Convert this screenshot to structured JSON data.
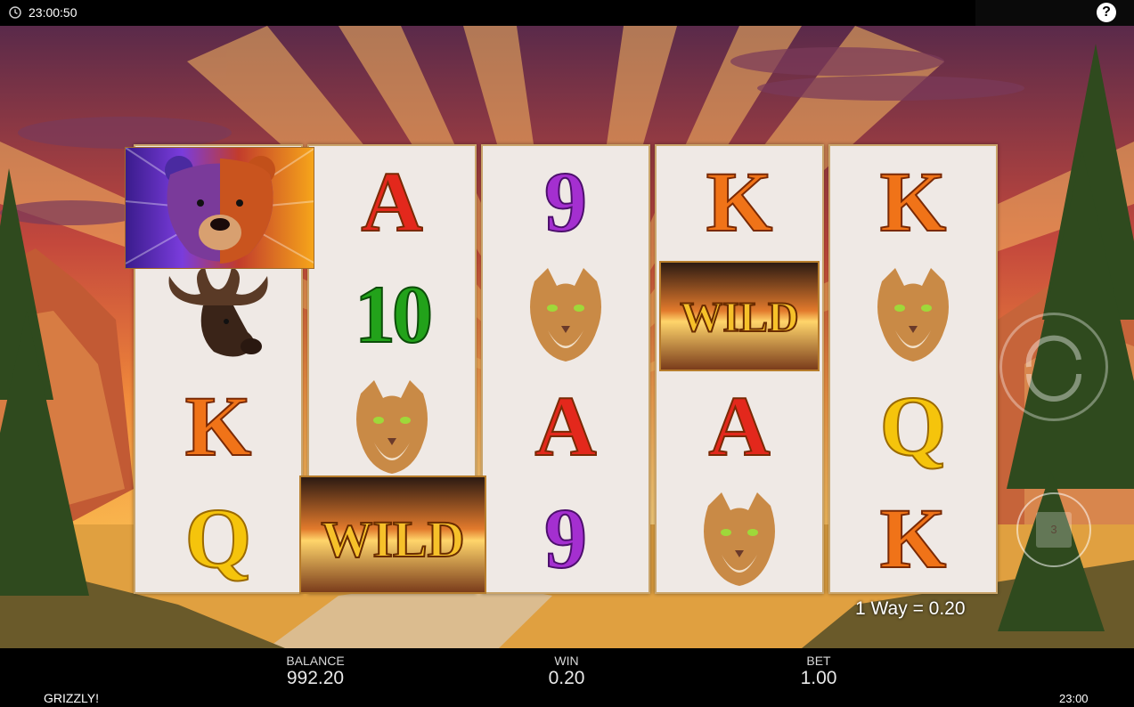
{
  "status_bar": {
    "time": "23:00:50",
    "help_label": "?"
  },
  "game": {
    "title": "GRIZZLY!",
    "ways_text": "1 Way = 0.20",
    "autoplay_count": "3",
    "clock": "23:00"
  },
  "reels": [
    [
      "bear",
      "moose",
      "K",
      "Q"
    ],
    [
      "A",
      "10",
      "cougar",
      "WILD"
    ],
    [
      "9",
      "cougar",
      "A",
      "9"
    ],
    [
      "K",
      "WILD",
      "A",
      "cougar"
    ],
    [
      "K",
      "cougar",
      "Q",
      "K"
    ]
  ],
  "symbols": {
    "A": "A",
    "K": "K",
    "Q": "Q",
    "nine": "9",
    "ten": "10",
    "wild": "WILD"
  },
  "hud": {
    "balance_label": "BALANCE",
    "balance_value": "992.20",
    "win_label": "WIN",
    "win_value": "0.20",
    "bet_label": "BET",
    "bet_value": "1.00"
  },
  "colors": {
    "reel_bg": "#efe9e5",
    "reel_border": "#c9a46a",
    "sky_top": "#5a2a4a",
    "sky_horizon": "#f7b24a"
  }
}
